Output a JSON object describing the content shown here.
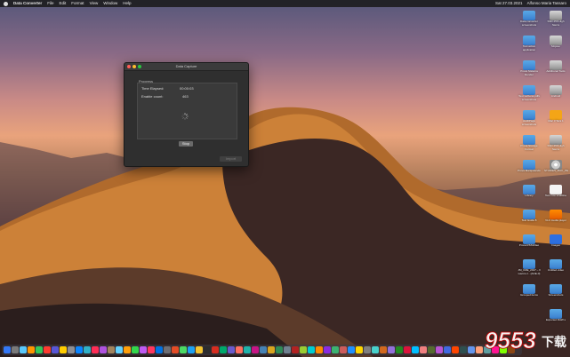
{
  "menubar": {
    "app_name": "Data Converter",
    "menus": [
      "File",
      "Edit",
      "Format",
      "View",
      "Window",
      "Help"
    ],
    "status_right": [
      "Sat 27.03.2021",
      "Alfonso Maria Tassaro"
    ]
  },
  "dialog": {
    "title": "Data Capture",
    "group_label": "Progress",
    "time_elapsed_label": "Time Elapsed:",
    "time_elapsed_value": "00:00:03",
    "enable_count_label": "Enable count:",
    "enable_count_value": "463",
    "stop_label": "Stop",
    "disabled_label": "Import"
  },
  "desktop_icons": [
    {
      "label": "Data converter screenshots",
      "type": "folder"
    },
    {
      "label": "SSD 256 High Sierra",
      "type": "drive"
    },
    {
      "label": "Test active application",
      "type": "folder"
    },
    {
      "label": "Mojave",
      "type": "drive"
    },
    {
      "label": "Prova Sistema Render",
      "type": "folder"
    },
    {
      "label": "Additional Tools",
      "type": "drive"
    },
    {
      "label": "Test verbena pdfs screenshots",
      "type": "folder"
    },
    {
      "label": "Android",
      "type": "drive"
    },
    {
      "label": "AuditPage screenshots",
      "type": "folder"
    },
    {
      "label": "Mac 3 Tera 1",
      "type": "orange"
    },
    {
      "label": "Prova Storage Format",
      "type": "folder"
    },
    {
      "label": "SSD 256 High Sierra",
      "type": "drive"
    },
    {
      "label": "Prova Manipulando",
      "type": "folder"
    },
    {
      "label": "STUDIES_MAC_PE...T19_16...1_2019.1",
      "type": "disc"
    },
    {
      "label": "Library",
      "type": "folder"
    },
    {
      "label": "Test now strabline",
      "type": "doc"
    },
    {
      "label": "Test Guide 8",
      "type": "folder"
    },
    {
      "label": "VLC media player",
      "type": "vlc"
    },
    {
      "label": "Prova RSSVideo",
      "type": "folder"
    },
    {
      "label": "Images",
      "type": "blueapp"
    },
    {
      "label": "JM_CRE_2017 – ll Lavoro c...(ACE-0)",
      "type": "folder"
    },
    {
      "label": "Untitled video",
      "type": "folder"
    },
    {
      "label": "Grouped items",
      "type": "folder"
    },
    {
      "label": "Screenshots",
      "type": "folder"
    },
    {
      "label": "Exported RAW s",
      "type": "folder"
    }
  ],
  "dock": {
    "icon_colors": [
      "#3478f6",
      "#7a7a7a",
      "#5ac8fa",
      "#ff9500",
      "#34c759",
      "#ff3b30",
      "#5856d6",
      "#ffcc00",
      "#8e8e93",
      "#0a84ff",
      "#30b0c7",
      "#ff2d55",
      "#af52de",
      "#a2845e",
      "#64d2ff",
      "#ff9f0a",
      "#32d74b",
      "#bf5af2",
      "#ff375f",
      "#0071e3",
      "#6e6e73",
      "#e34c26",
      "#4cd964",
      "#1da1f2",
      "#f4c430",
      "#2c2c2e",
      "#d62d20",
      "#00a86b",
      "#6a5acd",
      "#ff6f61",
      "#20b2aa",
      "#c71585",
      "#4682b4",
      "#daa520",
      "#2e8b57",
      "#708090",
      "#b22222",
      "#9acd32",
      "#00ced1",
      "#ff8c00",
      "#8a2be2",
      "#3cb371",
      "#cd5c5c",
      "#1e90ff",
      "#ffd700",
      "#808080",
      "#48d1cc",
      "#d2691e",
      "#9370db",
      "#228b22",
      "#dc143c",
      "#00bfff",
      "#f08080",
      "#556b2f",
      "#ba55d3",
      "#4169e1",
      "#ff4500",
      "#2f4f4f",
      "#6495ed",
      "#ffa07a",
      "#5f9ea0",
      "#ff1493",
      "#7fff00",
      "#8b4513"
    ]
  },
  "watermark": {
    "number": "9553",
    "suffix": "下载"
  }
}
